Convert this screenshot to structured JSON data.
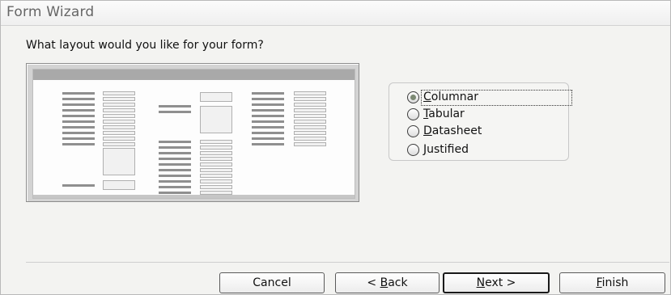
{
  "window": {
    "title": "Form Wizard"
  },
  "prompt": "What layout would you like for your form?",
  "layout_options": {
    "items": [
      {
        "label_first": "C",
        "label_rest": "olumnar",
        "selected": true
      },
      {
        "label_first": "T",
        "label_rest": "abular",
        "selected": false
      },
      {
        "label_first": "D",
        "label_rest": "atasheet",
        "selected": false
      },
      {
        "label_first": "J",
        "label_rest": "ustified",
        "selected": false
      }
    ]
  },
  "buttons": {
    "cancel": "Cancel",
    "back_prefix": "< ",
    "back_accel": "B",
    "back_rest": "ack",
    "next_accel": "N",
    "next_rest": "ext >",
    "finish_accel": "F",
    "finish_rest": "inish"
  },
  "colors": {
    "dialog_bg": "#f3f3f1",
    "title_text": "#666666",
    "radio_dot": "#7d8a74"
  }
}
